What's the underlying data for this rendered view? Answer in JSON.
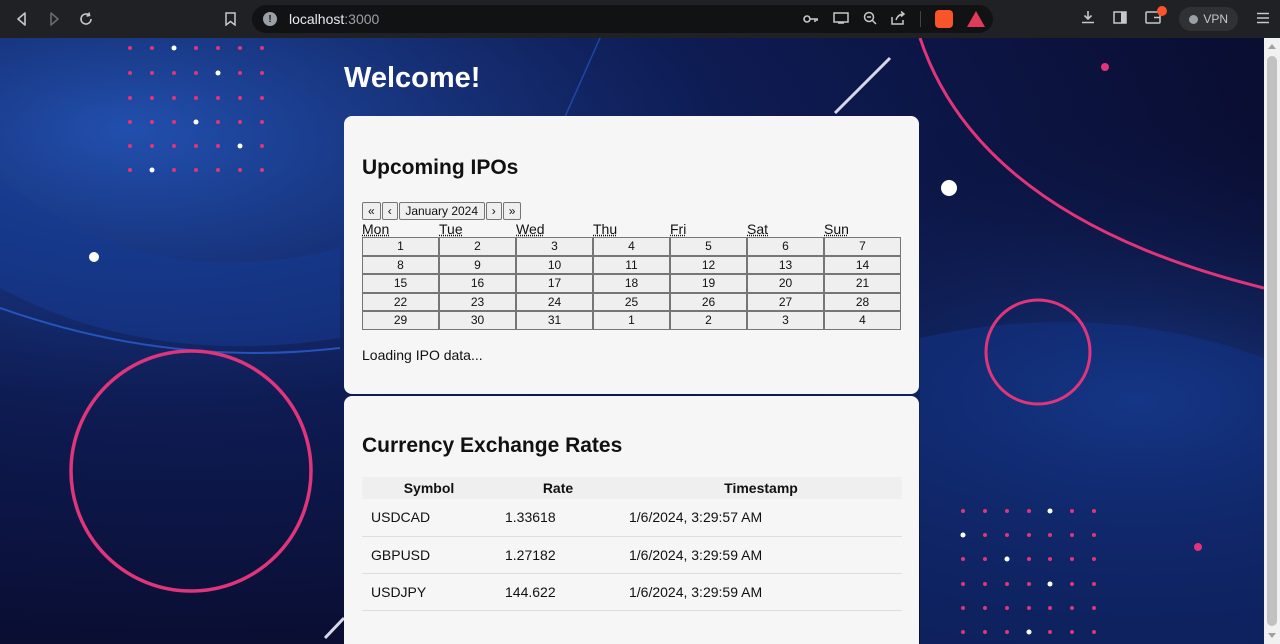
{
  "browser": {
    "url_host": "localhost",
    "url_port": ":3000",
    "vpn_label": "VPN",
    "icons": [
      "back-icon",
      "forward-icon",
      "reload-icon",
      "bookmark-icon",
      "info-icon",
      "key-icon",
      "cast-icon",
      "zoom-icon",
      "share-icon",
      "brave-shield-icon",
      "brave-rewards-icon",
      "download-icon",
      "sidebar-icon",
      "wallet-icon",
      "menu-icon"
    ]
  },
  "page": {
    "welcome": "Welcome!"
  },
  "ipo": {
    "title": "Upcoming IPOs",
    "nav": {
      "prev_year": "«",
      "prev_month": "‹",
      "month_label": "January 2024",
      "next_month": "›",
      "next_year": "»"
    },
    "weekdays": [
      "Mon",
      "Tue",
      "Wed",
      "Thu",
      "Fri",
      "Sat",
      "Sun"
    ],
    "days": [
      "1",
      "2",
      "3",
      "4",
      "5",
      "6",
      "7",
      "8",
      "9",
      "10",
      "11",
      "12",
      "13",
      "14",
      "15",
      "16",
      "17",
      "18",
      "19",
      "20",
      "21",
      "22",
      "23",
      "24",
      "25",
      "26",
      "27",
      "28",
      "29",
      "30",
      "31",
      "1",
      "2",
      "3",
      "4"
    ],
    "status": "Loading IPO data..."
  },
  "rates": {
    "title": "Currency Exchange Rates",
    "headers": [
      "Symbol",
      "Rate",
      "Timestamp"
    ],
    "rows": [
      [
        "USDCAD",
        "1.33618",
        "1/6/2024, 3:29:57 AM"
      ],
      [
        "GBPUSD",
        "1.27182",
        "1/6/2024, 3:29:59 AM"
      ],
      [
        "USDJPY",
        "144.622",
        "1/6/2024, 3:29:59 AM"
      ]
    ]
  },
  "colors": {
    "chrome_bg": "#202124",
    "accent_pink": "#e0357a",
    "card_bg": "#f6f6f6"
  }
}
